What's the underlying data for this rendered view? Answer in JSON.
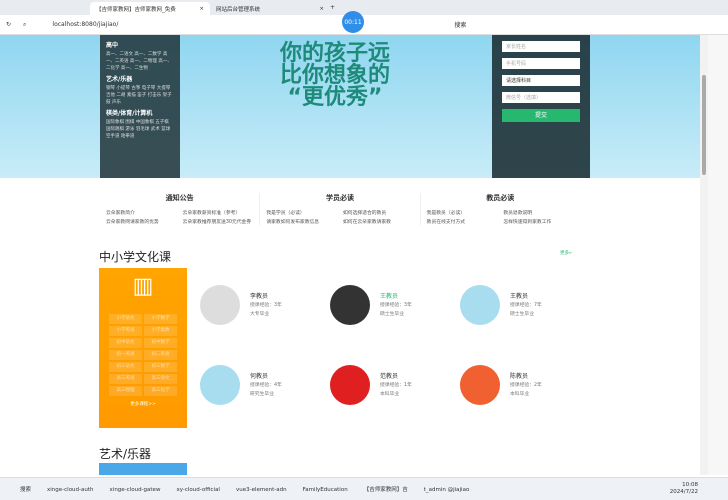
{
  "browser": {
    "tabs": [
      "【吉师家教网】吉师家教网_免费",
      "网站后台管理系统"
    ],
    "url": "localhost:8080/jiajiao/",
    "timer": "00:11",
    "search": "搜索"
  },
  "banner": {
    "slogan1": "你的孩子远",
    "slogan2": "比你想象的",
    "slogan3": "“更优秀”",
    "menu": [
      {
        "title": "高中",
        "items": "高一、二语文 高一、二数学 高一、二英语 高一、二物理 高一、二化学 高一、二生物"
      },
      {
        "title": "艺术/乐器",
        "items": "钢琴 小提琴 古筝 电子琴 大提琴 吉他 二胡 素描 笛子 打击乐 架子鼓 声乐"
      },
      {
        "title": "棋类/体育/计算机",
        "items": "国际象棋 围棋 中国象棋 五子棋 国际跳棋 游泳 羽毛球 武术 篮球 空手道 跆拳道"
      }
    ],
    "form": {
      "name_ph": "家长姓名",
      "phone_ph": "手机号码",
      "subject": "请选择科目",
      "qq_ph": "微信号（选填）",
      "submit": "提交"
    }
  },
  "notices": [
    {
      "title": "通知公告",
      "links": [
        "云朵家教简介",
        "云朵家教薪资标准（参考）",
        "云朵家教网请家教的优势",
        "云朵家教推荐朋友送30元代金券"
      ]
    },
    {
      "title": "学员必读",
      "links": [
        "我是学员（必读）",
        "如何选择适合的教员",
        "请家教如何发布家教信息",
        "如何在云朵家教请家教"
      ]
    },
    {
      "title": "教员必读",
      "links": [
        "我是教员（必读）",
        "教员退款说明",
        "教员在线支付方式",
        "怎样快速得到家教工作"
      ]
    }
  ],
  "section1": {
    "title": "中小学文化课",
    "more": "更多»",
    "grid": [
      "小学语文",
      "小学数学",
      "小学英语",
      "小学奥数",
      "初中语文",
      "初中数学",
      "初一英语",
      "初二英语",
      "初三语文",
      "初三数学",
      "高三英语",
      "高三语文",
      "高三物理",
      "高三化学"
    ],
    "more_courses": "更多课程>>"
  },
  "teachers": [
    {
      "name": "李教员",
      "exp": "授课经验：3年",
      "edu": "大专毕业",
      "color": "#ddd"
    },
    {
      "name": "王教员",
      "exp": "授课经验：3年",
      "edu": "硕士生毕业",
      "color": "#333"
    },
    {
      "name": "王教员",
      "exp": "授课经验：7年",
      "edu": "硕士生毕业",
      "color": "#a8dcef"
    },
    {
      "name": "何教员",
      "exp": "授课经验：4年",
      "edu": "研究生毕业",
      "color": "#a8dcef"
    },
    {
      "name": "范教员",
      "exp": "授课经验：1年",
      "edu": "本科毕业",
      "color": "#e02020"
    },
    {
      "name": "陈教员",
      "exp": "授课经验：2年",
      "edu": "本科毕业",
      "color": "#f06030"
    }
  ],
  "section2": {
    "title": "艺术/乐器"
  },
  "taskbar": {
    "search": "搜索",
    "apps": [
      "xinge-cloud-auth",
      "xinge-cloud-gatew",
      "xy-cloud-official",
      "vue3-element-adn",
      "FamilyEducation",
      "【吉师家教网】吉",
      "t_admin @jiajiao"
    ],
    "time": "10:08",
    "date": "2024/7/22"
  }
}
